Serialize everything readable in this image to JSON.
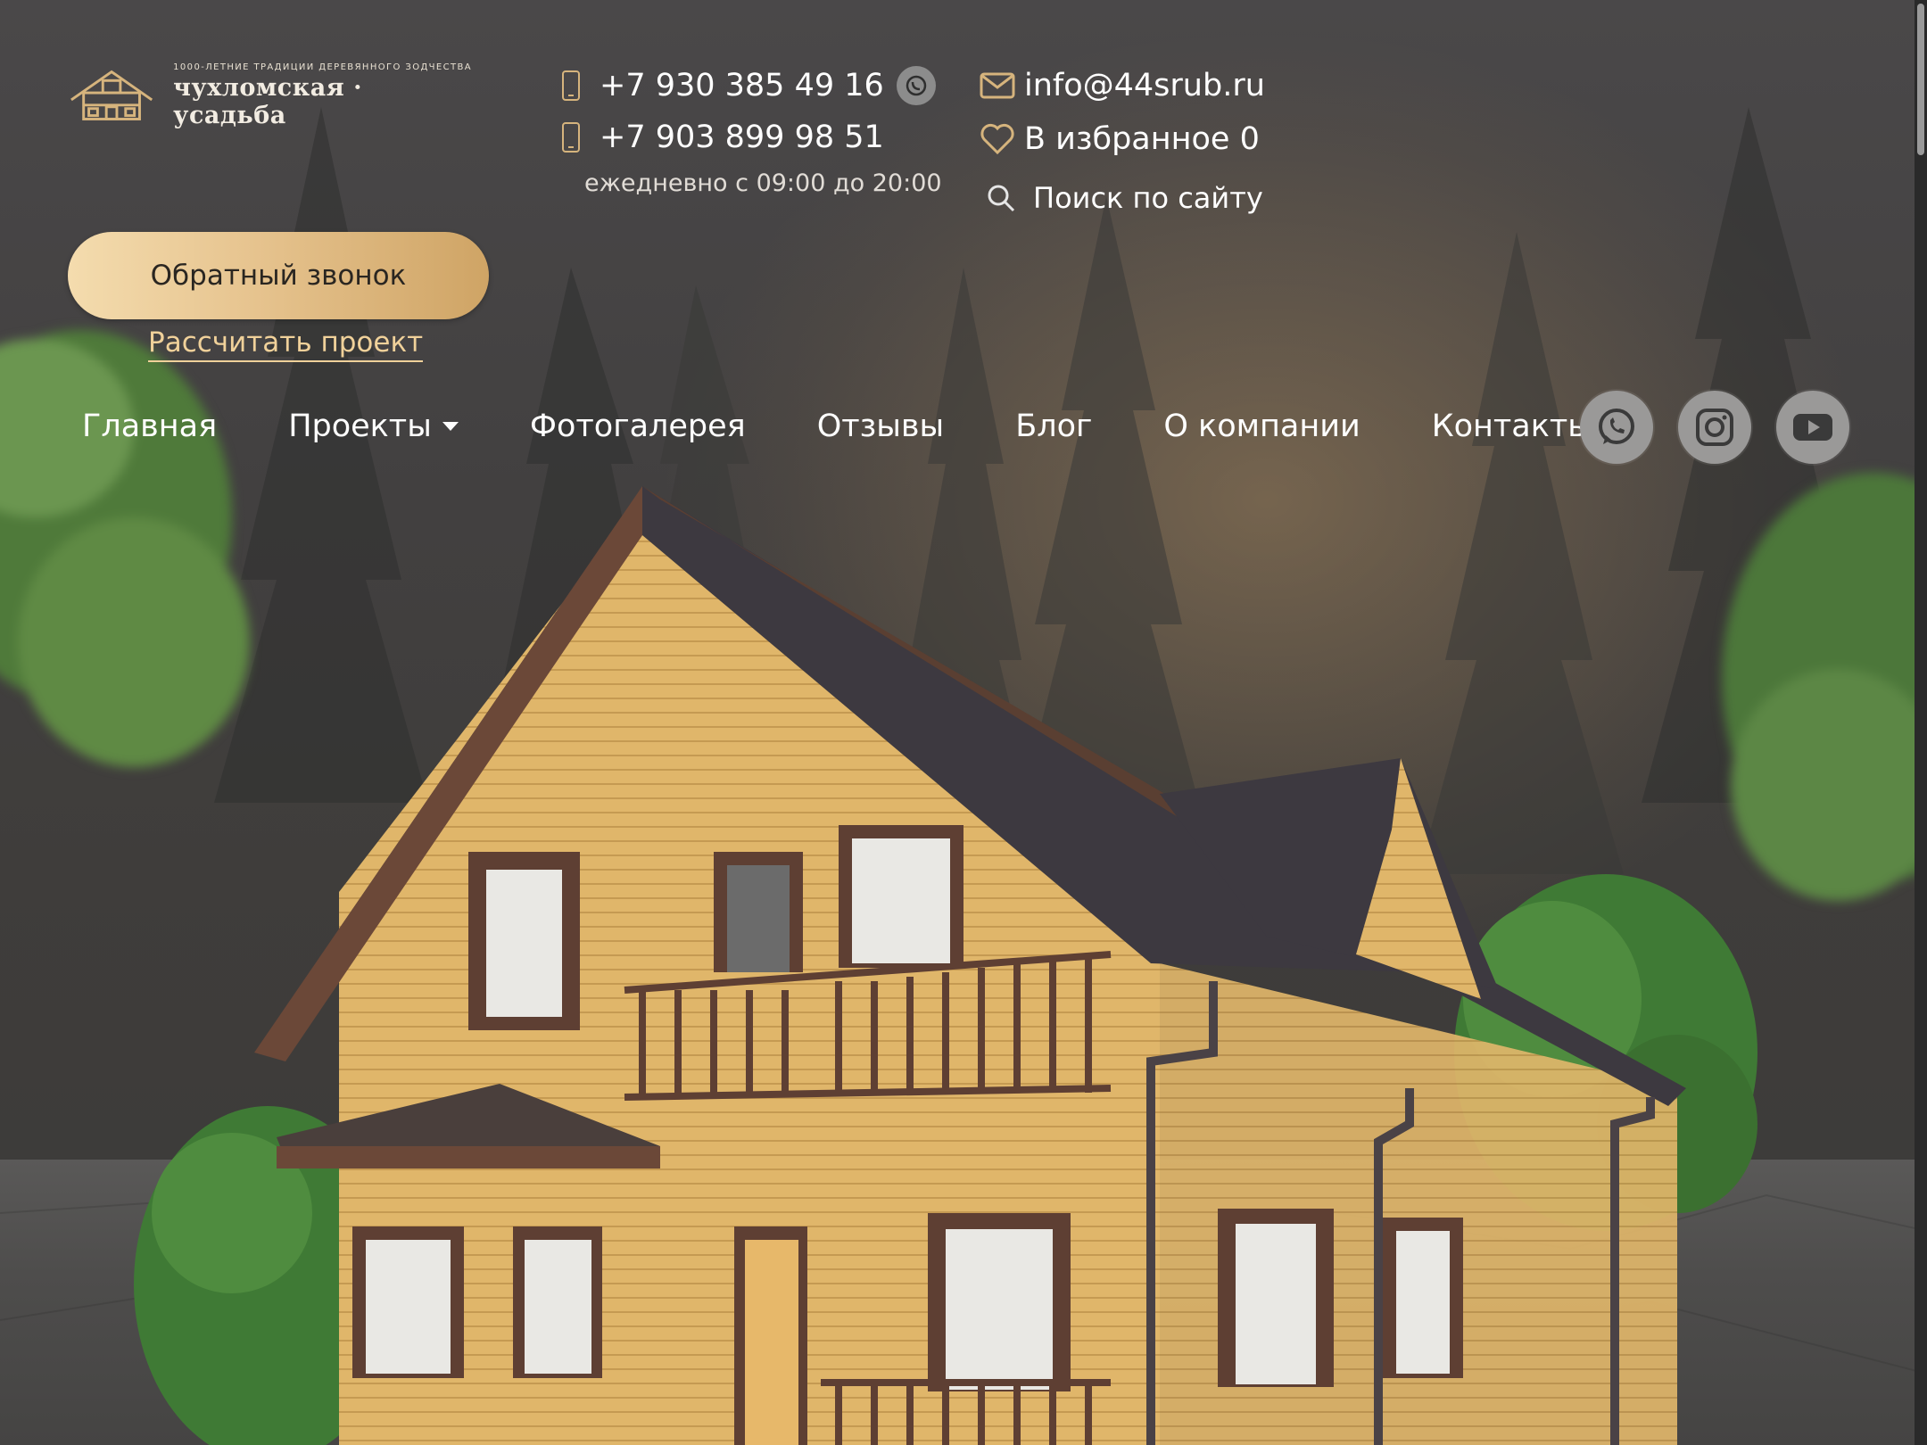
{
  "brand": {
    "tagline": "1000-ЛЕТНИЕ ТРАДИЦИИ ДЕРЕВЯННОГО ЗОДЧЕСТВА",
    "name": "чухломская · усадьба"
  },
  "contacts": {
    "phone1": "+7 930 385 49 16",
    "phone2": "+7 903 899 98 51",
    "hours": "ежедневно с 09:00 до 20:00",
    "email": "info@44srub.ru",
    "favorites": "В избранное 0",
    "search": "Поиск по сайту"
  },
  "actions": {
    "callback": "Обратный звонок",
    "calculate": "Рассчитать проект"
  },
  "nav": {
    "items": [
      "Главная",
      "Проекты",
      "Фотогалерея",
      "Отзывы",
      "Блог",
      "О компании",
      "Контакты"
    ]
  },
  "social": [
    "whatsapp-icon",
    "instagram-icon",
    "youtube-icon"
  ],
  "colors": {
    "accent": "#d6b47d",
    "button_gradient_start": "#f4dcae",
    "button_gradient_end": "#cfa465",
    "link": "#f0d19a"
  }
}
